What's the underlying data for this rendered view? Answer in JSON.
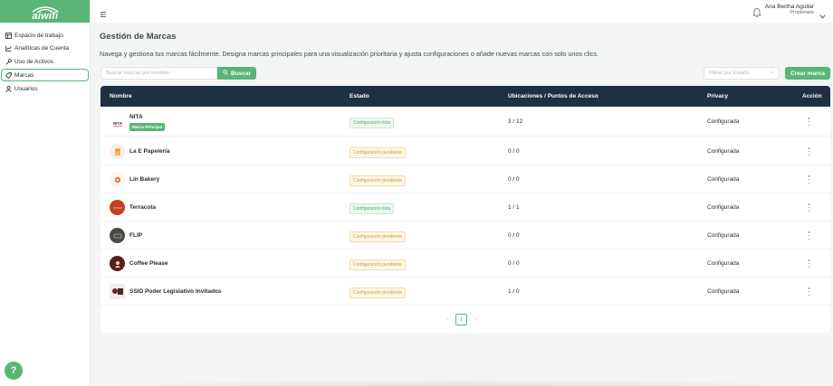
{
  "app": {
    "logo_text": "aiwifi",
    "accent": "#5bb577",
    "header_bg": "#1f3040"
  },
  "sidebar": {
    "items": [
      {
        "label": "Espacio de trabajo",
        "icon": "workspace-icon",
        "active": false
      },
      {
        "label": "Analíticas de Cuenta",
        "icon": "chart-icon",
        "active": false
      },
      {
        "label": "Uso de Activos",
        "icon": "key-icon",
        "active": false
      },
      {
        "label": "Marcas",
        "icon": "tag-icon",
        "active": true
      },
      {
        "label": "Usuarios",
        "icon": "user-icon",
        "active": false
      }
    ],
    "help_label": "?"
  },
  "topbar": {
    "user_name": "Ana Bertha Aguilar",
    "user_role": "Propietario"
  },
  "page": {
    "title": "Gestión de Marcas",
    "description": "Navega y gestiona tus marcas fácilmente. Designa marcas principales para una visualización prioritaria y ajusta configuraciones o añade nuevas marcas con solo unos clics."
  },
  "toolbar": {
    "search_placeholder": "Buscar marcas por nombre",
    "search_label": "Buscar",
    "state_placeholder": "Filtrar por Estado",
    "create_label": "Crear marca"
  },
  "table": {
    "headers": {
      "name": "Nombre",
      "status": "Estado",
      "locations": "Ubicaciones / Puntos de Acceso",
      "privacy": "Privacy",
      "action": "Acción"
    },
    "main_badge": "Marca Principal",
    "rows": [
      {
        "name": "NITA",
        "status": "Configuración lista",
        "status_type": "ok",
        "locations": "3 / 12",
        "privacy": "Configurada",
        "main": true
      },
      {
        "name": "La E Papelería",
        "status": "Configuración pendiente",
        "status_type": "pending",
        "locations": "0 / 0",
        "privacy": "Configurada",
        "main": false
      },
      {
        "name": "Lin Bakery",
        "status": "Configuración pendiente",
        "status_type": "pending",
        "locations": "0 / 0",
        "privacy": "Configurada",
        "main": false
      },
      {
        "name": "Terracota",
        "status": "Configuración lista",
        "status_type": "ok",
        "locations": "1 / 1",
        "privacy": "Configurada",
        "main": false
      },
      {
        "name": "FLIP",
        "status": "Configuración pendiente",
        "status_type": "pending",
        "locations": "0 / 0",
        "privacy": "Configurada",
        "main": false
      },
      {
        "name": "Coffee Please",
        "status": "Configuración pendiente",
        "status_type": "pending",
        "locations": "0 / 0",
        "privacy": "Configurada",
        "main": false
      },
      {
        "name": "SSID Poder Legislativo Invitados",
        "status": "Configuración pendiente",
        "status_type": "pending",
        "locations": "1 / 0",
        "privacy": "Configurada",
        "main": false
      }
    ]
  },
  "pagination": {
    "current": "1"
  }
}
